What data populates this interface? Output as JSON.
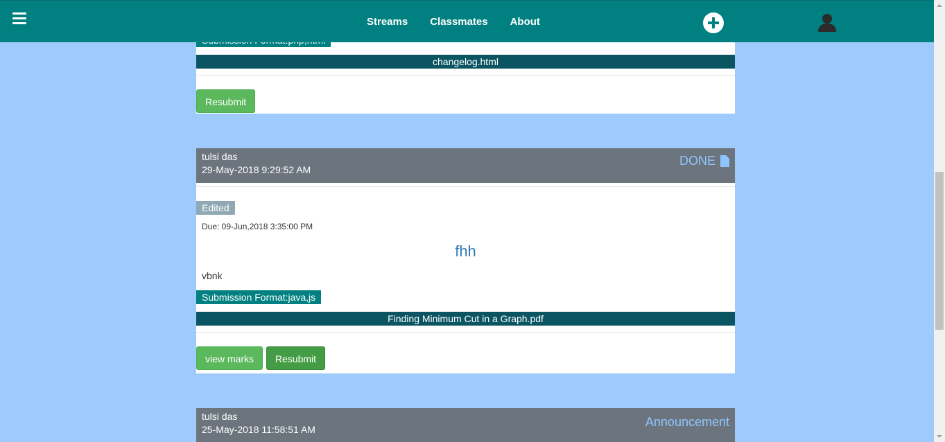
{
  "nav": {
    "links": [
      "Streams",
      "Classmates",
      "About"
    ]
  },
  "card1": {
    "format": "Submission Format:php,html",
    "file": "changelog.html",
    "resubmit": "Resubmit"
  },
  "card2": {
    "author": "tulsi das",
    "timestamp": "29-May-2018 9:29:52 AM",
    "status": "DONE",
    "edited": "Edited",
    "due": "Due: 09-Jun,2018 3:35:00 PM",
    "title": "fhh",
    "description": "vbnk",
    "format": "Submission Format:java,js",
    "file": "Finding Minimum Cut in a Graph.pdf",
    "view_marks": "view marks",
    "resubmit": "Resubmit"
  },
  "card3": {
    "author": "tulsi das",
    "timestamp": "25-May-2018 11:58:51 AM",
    "status": "Announcement"
  },
  "colors": {
    "navbar": "#008080",
    "page_bg": "#9ecbfb",
    "card_header": "#6c757d",
    "status_text": "#8fc5ff",
    "file_bar": "#0b5563",
    "button": "#5cb85c"
  },
  "icons": {
    "menu": "hamburger-icon",
    "add": "plus-circle-icon",
    "user": "user-icon",
    "status": "file-icon"
  }
}
